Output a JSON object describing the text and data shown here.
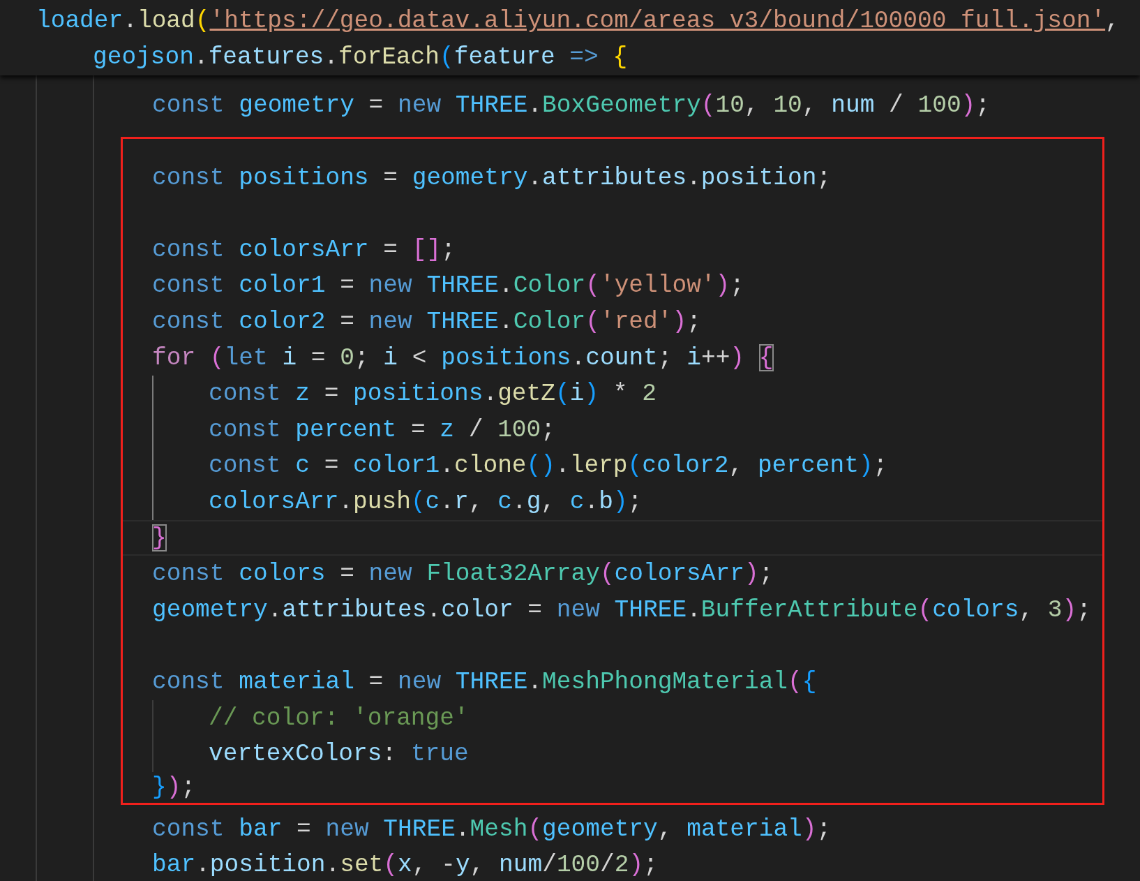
{
  "sticky_scroll": [
    {
      "kind": "code",
      "tokens": [
        {
          "kind": "cvar",
          "text": "loader"
        },
        {
          "kind": "p",
          "text": "."
        },
        {
          "kind": "fn",
          "text": "load"
        },
        {
          "kind": "br1",
          "text": "("
        },
        {
          "kind": "link",
          "text": "'https://geo.datav.aliyun.com/areas_v3/bound/100000_full.json'"
        },
        {
          "kind": "p",
          "text": ","
        }
      ],
      "children": [
        {
          "kind": "code",
          "tokens": [
            {
              "kind": "cvar",
              "text": "geojson"
            },
            {
              "kind": "p",
              "text": "."
            },
            {
              "kind": "var",
              "text": "features"
            },
            {
              "kind": "p",
              "text": "."
            },
            {
              "kind": "fn",
              "text": "forEach"
            },
            {
              "kind": "br3",
              "text": "("
            },
            {
              "kind": "var",
              "text": "feature"
            },
            {
              "kind": "kw",
              "text": " => "
            },
            {
              "kind": "br1",
              "text": "{"
            }
          ]
        }
      ]
    }
  ],
  "lines_before": [
    {
      "kind": "code",
      "tokens": [
        {
          "kind": "kw",
          "text": "const "
        },
        {
          "kind": "cvar",
          "text": "geometry"
        },
        {
          "kind": "p",
          "text": " = "
        },
        {
          "kind": "kw",
          "text": "new "
        },
        {
          "kind": "cvar",
          "text": "THREE"
        },
        {
          "kind": "p",
          "text": "."
        },
        {
          "kind": "cls",
          "text": "BoxGeometry"
        },
        {
          "kind": "br2",
          "text": "("
        },
        {
          "kind": "num",
          "text": "10"
        },
        {
          "kind": "p",
          "text": ", "
        },
        {
          "kind": "num",
          "text": "10"
        },
        {
          "kind": "p",
          "text": ", "
        },
        {
          "kind": "var",
          "text": "num"
        },
        {
          "kind": "p",
          "text": " / "
        },
        {
          "kind": "num",
          "text": "100"
        },
        {
          "kind": "br2",
          "text": ")"
        },
        {
          "kind": "p",
          "text": ";"
        }
      ]
    }
  ],
  "highlighted_lines": [
    {
      "kind": "blank"
    },
    {
      "kind": "code",
      "tokens": [
        {
          "kind": "kw",
          "text": "const "
        },
        {
          "kind": "cvar",
          "text": "positions"
        },
        {
          "kind": "p",
          "text": " = "
        },
        {
          "kind": "cvar",
          "text": "geometry"
        },
        {
          "kind": "p",
          "text": "."
        },
        {
          "kind": "var",
          "text": "attributes"
        },
        {
          "kind": "p",
          "text": "."
        },
        {
          "kind": "var",
          "text": "position"
        },
        {
          "kind": "p",
          "text": ";"
        }
      ]
    },
    {
      "kind": "blank"
    },
    {
      "kind": "code",
      "tokens": [
        {
          "kind": "kw",
          "text": "const "
        },
        {
          "kind": "cvar",
          "text": "colorsArr"
        },
        {
          "kind": "p",
          "text": " = "
        },
        {
          "kind": "br2",
          "text": "[]"
        },
        {
          "kind": "p",
          "text": ";"
        }
      ]
    },
    {
      "kind": "code",
      "tokens": [
        {
          "kind": "kw",
          "text": "const "
        },
        {
          "kind": "cvar",
          "text": "color1"
        },
        {
          "kind": "p",
          "text": " = "
        },
        {
          "kind": "kw",
          "text": "new "
        },
        {
          "kind": "cvar",
          "text": "THREE"
        },
        {
          "kind": "p",
          "text": "."
        },
        {
          "kind": "cls",
          "text": "Color"
        },
        {
          "kind": "br2",
          "text": "("
        },
        {
          "kind": "str",
          "text": "'yellow'"
        },
        {
          "kind": "br2",
          "text": ")"
        },
        {
          "kind": "p",
          "text": ";"
        }
      ]
    },
    {
      "kind": "code",
      "tokens": [
        {
          "kind": "kw",
          "text": "const "
        },
        {
          "kind": "cvar",
          "text": "color2"
        },
        {
          "kind": "p",
          "text": " = "
        },
        {
          "kind": "kw",
          "text": "new "
        },
        {
          "kind": "cvar",
          "text": "THREE"
        },
        {
          "kind": "p",
          "text": "."
        },
        {
          "kind": "cls",
          "text": "Color"
        },
        {
          "kind": "br2",
          "text": "("
        },
        {
          "kind": "str",
          "text": "'red'"
        },
        {
          "kind": "br2",
          "text": ")"
        },
        {
          "kind": "p",
          "text": ";"
        }
      ]
    },
    {
      "kind": "code",
      "tokens": [
        {
          "kind": "ctrl",
          "text": "for "
        },
        {
          "kind": "br2",
          "text": "("
        },
        {
          "kind": "kw",
          "text": "let "
        },
        {
          "kind": "var",
          "text": "i"
        },
        {
          "kind": "p",
          "text": " = "
        },
        {
          "kind": "num",
          "text": "0"
        },
        {
          "kind": "p",
          "text": "; "
        },
        {
          "kind": "var",
          "text": "i"
        },
        {
          "kind": "p",
          "text": " < "
        },
        {
          "kind": "cvar",
          "text": "positions"
        },
        {
          "kind": "p",
          "text": "."
        },
        {
          "kind": "var",
          "text": "count"
        },
        {
          "kind": "p",
          "text": "; "
        },
        {
          "kind": "var",
          "text": "i"
        },
        {
          "kind": "p",
          "text": "++"
        },
        {
          "kind": "br2",
          "text": ") "
        },
        {
          "kind": "br2match",
          "text": "{"
        }
      ],
      "children": [
        {
          "kind": "code",
          "tokens": [
            {
              "kind": "kw",
              "text": "const "
            },
            {
              "kind": "cvar",
              "text": "z"
            },
            {
              "kind": "p",
              "text": " = "
            },
            {
              "kind": "cvar",
              "text": "positions"
            },
            {
              "kind": "p",
              "text": "."
            },
            {
              "kind": "fn",
              "text": "getZ"
            },
            {
              "kind": "br3",
              "text": "("
            },
            {
              "kind": "var",
              "text": "i"
            },
            {
              "kind": "br3",
              "text": ")"
            },
            {
              "kind": "p",
              "text": " * "
            },
            {
              "kind": "num",
              "text": "2"
            }
          ]
        },
        {
          "kind": "code",
          "tokens": [
            {
              "kind": "kw",
              "text": "const "
            },
            {
              "kind": "cvar",
              "text": "percent"
            },
            {
              "kind": "p",
              "text": " = "
            },
            {
              "kind": "cvar",
              "text": "z"
            },
            {
              "kind": "p",
              "text": " / "
            },
            {
              "kind": "num",
              "text": "100"
            },
            {
              "kind": "p",
              "text": ";"
            }
          ]
        },
        {
          "kind": "code",
          "tokens": [
            {
              "kind": "kw",
              "text": "const "
            },
            {
              "kind": "cvar",
              "text": "c"
            },
            {
              "kind": "p",
              "text": " = "
            },
            {
              "kind": "cvar",
              "text": "color1"
            },
            {
              "kind": "p",
              "text": "."
            },
            {
              "kind": "fn",
              "text": "clone"
            },
            {
              "kind": "br3",
              "text": "()"
            },
            {
              "kind": "p",
              "text": "."
            },
            {
              "kind": "fn",
              "text": "lerp"
            },
            {
              "kind": "br3",
              "text": "("
            },
            {
              "kind": "cvar",
              "text": "color2"
            },
            {
              "kind": "p",
              "text": ", "
            },
            {
              "kind": "cvar",
              "text": "percent"
            },
            {
              "kind": "br3",
              "text": ")"
            },
            {
              "kind": "p",
              "text": ";"
            }
          ]
        },
        {
          "kind": "code",
          "tokens": [
            {
              "kind": "cvar",
              "text": "colorsArr"
            },
            {
              "kind": "p",
              "text": "."
            },
            {
              "kind": "fn",
              "text": "push"
            },
            {
              "kind": "br3",
              "text": "("
            },
            {
              "kind": "cvar",
              "text": "c"
            },
            {
              "kind": "p",
              "text": "."
            },
            {
              "kind": "var",
              "text": "r"
            },
            {
              "kind": "p",
              "text": ", "
            },
            {
              "kind": "cvar",
              "text": "c"
            },
            {
              "kind": "p",
              "text": "."
            },
            {
              "kind": "var",
              "text": "g"
            },
            {
              "kind": "p",
              "text": ", "
            },
            {
              "kind": "cvar",
              "text": "c"
            },
            {
              "kind": "p",
              "text": "."
            },
            {
              "kind": "var",
              "text": "b"
            },
            {
              "kind": "br3",
              "text": ")"
            },
            {
              "kind": "p",
              "text": ";"
            }
          ]
        }
      ]
    },
    {
      "kind": "current",
      "tokens": [
        {
          "kind": "br2match",
          "text": "}"
        }
      ]
    },
    {
      "kind": "code",
      "tokens": [
        {
          "kind": "kw",
          "text": "const "
        },
        {
          "kind": "cvar",
          "text": "colors"
        },
        {
          "kind": "p",
          "text": " = "
        },
        {
          "kind": "kw",
          "text": "new "
        },
        {
          "kind": "cls",
          "text": "Float32Array"
        },
        {
          "kind": "br2",
          "text": "("
        },
        {
          "kind": "cvar",
          "text": "colorsArr"
        },
        {
          "kind": "br2",
          "text": ")"
        },
        {
          "kind": "p",
          "text": ";"
        }
      ]
    },
    {
      "kind": "code",
      "tokens": [
        {
          "kind": "cvar",
          "text": "geometry"
        },
        {
          "kind": "p",
          "text": "."
        },
        {
          "kind": "var",
          "text": "attributes"
        },
        {
          "kind": "p",
          "text": "."
        },
        {
          "kind": "var",
          "text": "color"
        },
        {
          "kind": "p",
          "text": " = "
        },
        {
          "kind": "kw",
          "text": "new "
        },
        {
          "kind": "cvar",
          "text": "THREE"
        },
        {
          "kind": "p",
          "text": "."
        },
        {
          "kind": "cls",
          "text": "BufferAttribute"
        },
        {
          "kind": "br2",
          "text": "("
        },
        {
          "kind": "cvar",
          "text": "colors"
        },
        {
          "kind": "p",
          "text": ", "
        },
        {
          "kind": "num",
          "text": "3"
        },
        {
          "kind": "br2",
          "text": ")"
        },
        {
          "kind": "p",
          "text": ";"
        }
      ]
    },
    {
      "kind": "blank"
    },
    {
      "kind": "code",
      "tokens": [
        {
          "kind": "kw",
          "text": "const "
        },
        {
          "kind": "cvar",
          "text": "material"
        },
        {
          "kind": "p",
          "text": " = "
        },
        {
          "kind": "kw",
          "text": "new "
        },
        {
          "kind": "cvar",
          "text": "THREE"
        },
        {
          "kind": "p",
          "text": "."
        },
        {
          "kind": "cls",
          "text": "MeshPhongMaterial"
        },
        {
          "kind": "br2",
          "text": "("
        },
        {
          "kind": "br3",
          "text": "{"
        }
      ],
      "children": [
        {
          "kind": "code",
          "tokens": [
            {
              "kind": "cm",
              "text": "// color: 'orange'"
            }
          ]
        },
        {
          "kind": "code",
          "tokens": [
            {
              "kind": "var",
              "text": "vertexColors"
            },
            {
              "kind": "p",
              "text": ": "
            },
            {
              "kind": "kw",
              "text": "true"
            }
          ]
        }
      ]
    },
    {
      "kind": "code",
      "tokens": [
        {
          "kind": "br3",
          "text": "}"
        },
        {
          "kind": "br2",
          "text": ")"
        },
        {
          "kind": "p",
          "text": ";"
        }
      ]
    }
  ],
  "lines_after": [
    {
      "kind": "code",
      "tokens": [
        {
          "kind": "kw",
          "text": "const "
        },
        {
          "kind": "cvar",
          "text": "bar"
        },
        {
          "kind": "p",
          "text": " = "
        },
        {
          "kind": "kw",
          "text": "new "
        },
        {
          "kind": "cvar",
          "text": "THREE"
        },
        {
          "kind": "p",
          "text": "."
        },
        {
          "kind": "cls",
          "text": "Mesh"
        },
        {
          "kind": "br2",
          "text": "("
        },
        {
          "kind": "cvar",
          "text": "geometry"
        },
        {
          "kind": "p",
          "text": ", "
        },
        {
          "kind": "cvar",
          "text": "material"
        },
        {
          "kind": "br2",
          "text": ")"
        },
        {
          "kind": "p",
          "text": ";"
        }
      ]
    },
    {
      "kind": "code",
      "tokens": [
        {
          "kind": "cvar",
          "text": "bar"
        },
        {
          "kind": "p",
          "text": "."
        },
        {
          "kind": "var",
          "text": "position"
        },
        {
          "kind": "p",
          "text": "."
        },
        {
          "kind": "fn",
          "text": "set"
        },
        {
          "kind": "br2",
          "text": "("
        },
        {
          "kind": "var",
          "text": "x"
        },
        {
          "kind": "p",
          "text": ", -"
        },
        {
          "kind": "var",
          "text": "y"
        },
        {
          "kind": "p",
          "text": ", "
        },
        {
          "kind": "var",
          "text": "num"
        },
        {
          "kind": "p",
          "text": "/"
        },
        {
          "kind": "num",
          "text": "100"
        },
        {
          "kind": "p",
          "text": "/"
        },
        {
          "kind": "num",
          "text": "2"
        },
        {
          "kind": "br2",
          "text": ")"
        },
        {
          "kind": "p",
          "text": ";"
        }
      ]
    }
  ]
}
